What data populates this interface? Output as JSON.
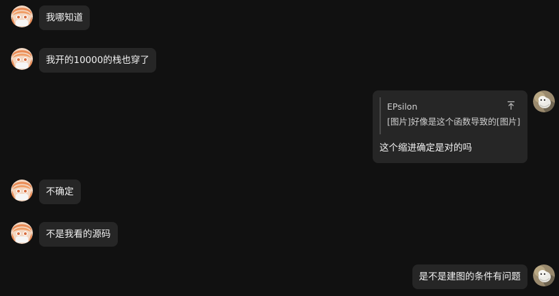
{
  "messages": [
    {
      "side": "left",
      "avatar": "anime-girl-avatar",
      "text": "我哪知道"
    },
    {
      "side": "left",
      "avatar": "anime-girl-avatar",
      "text": "我开的10000的栈也穿了"
    },
    {
      "side": "right",
      "avatar": "cat-photo-avatar",
      "quote": {
        "author": "EPsilon",
        "text": "[图片]好像是这个函数导致的[图片]"
      },
      "text": "这个缩进确定是对的吗"
    },
    {
      "side": "left",
      "avatar": "anime-girl-avatar",
      "text": "不确定"
    },
    {
      "side": "left",
      "avatar": "anime-girl-avatar",
      "text": "不是我看的源码"
    },
    {
      "side": "right",
      "avatar": "cat-photo-avatar",
      "text": "是不是建图的条件有问题"
    }
  ],
  "icons": {
    "quote_jump": "jump-to-top-icon"
  },
  "colors": {
    "background": "#111111",
    "bubble": "#262626",
    "text": "#f2f2f2",
    "quote_bar": "#4a4a4a"
  }
}
